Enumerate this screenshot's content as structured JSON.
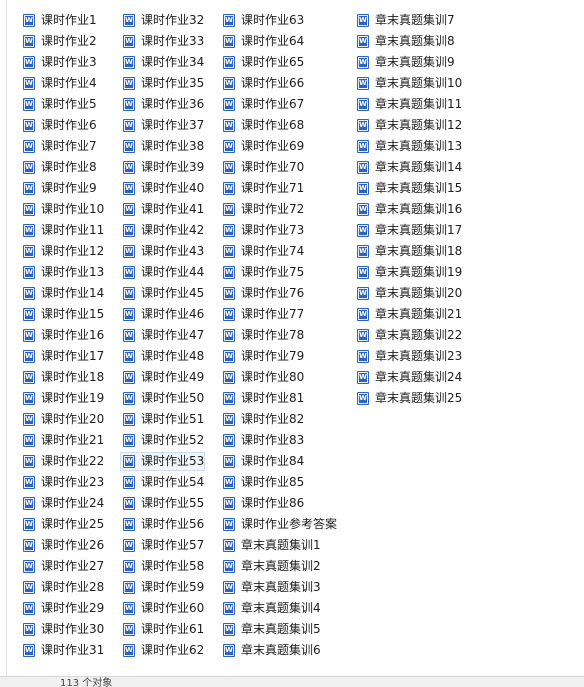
{
  "status": {
    "text": "113 个对象"
  },
  "icon": "word-document-icon",
  "selected_item": "课时作业53",
  "columns": [
    [
      "课时作业1",
      "课时作业2",
      "课时作业3",
      "课时作业4",
      "课时作业5",
      "课时作业6",
      "课时作业7",
      "课时作业8",
      "课时作业9",
      "课时作业10",
      "课时作业11",
      "课时作业12",
      "课时作业13",
      "课时作业14",
      "课时作业15",
      "课时作业16",
      "课时作业17",
      "课时作业18",
      "课时作业19",
      "课时作业20",
      "课时作业21",
      "课时作业22",
      "课时作业23",
      "课时作业24",
      "课时作业25",
      "课时作业26",
      "课时作业27",
      "课时作业28",
      "课时作业29",
      "课时作业30",
      "课时作业31"
    ],
    [
      "课时作业32",
      "课时作业33",
      "课时作业34",
      "课时作业35",
      "课时作业36",
      "课时作业37",
      "课时作业38",
      "课时作业39",
      "课时作业40",
      "课时作业41",
      "课时作业42",
      "课时作业43",
      "课时作业44",
      "课时作业45",
      "课时作业46",
      "课时作业47",
      "课时作业48",
      "课时作业49",
      "课时作业50",
      "课时作业51",
      "课时作业52",
      "课时作业53",
      "课时作业54",
      "课时作业55",
      "课时作业56",
      "课时作业57",
      "课时作业58",
      "课时作业59",
      "课时作业60",
      "课时作业61",
      "课时作业62"
    ],
    [
      "课时作业63",
      "课时作业64",
      "课时作业65",
      "课时作业66",
      "课时作业67",
      "课时作业68",
      "课时作业69",
      "课时作业70",
      "课时作业71",
      "课时作业72",
      "课时作业73",
      "课时作业74",
      "课时作业75",
      "课时作业76",
      "课时作业77",
      "课时作业78",
      "课时作业79",
      "课时作业80",
      "课时作业81",
      "课时作业82",
      "课时作业83",
      "课时作业84",
      "课时作业85",
      "课时作业86",
      "课时作业参考答案",
      "章末真题集训1",
      "章末真题集训2",
      "章末真题集训3",
      "章末真题集训4",
      "章末真题集训5",
      "章末真题集训6"
    ],
    [
      "章末真题集训7",
      "章末真题集训8",
      "章末真题集训9",
      "章末真题集训10",
      "章末真题集训11",
      "章末真题集训12",
      "章末真题集训13",
      "章末真题集训14",
      "章末真题集训15",
      "章末真题集训16",
      "章末真题集训17",
      "章末真题集训18",
      "章末真题集训19",
      "章末真题集训20",
      "章末真题集训21",
      "章末真题集训22",
      "章末真题集训23",
      "章末真题集训24",
      "章末真题集训25"
    ]
  ]
}
